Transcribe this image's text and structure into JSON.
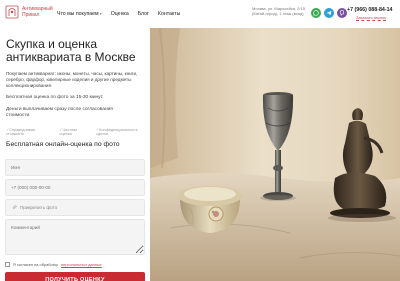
{
  "header": {
    "logo": {
      "line1": "Антикварный",
      "line2": "Привал"
    },
    "nav": [
      {
        "label": "Что мы покупаем",
        "dropdown": true
      },
      {
        "label": "Оценка",
        "dropdown": false
      },
      {
        "label": "Блог",
        "dropdown": false
      },
      {
        "label": "Контакты",
        "dropdown": false
      }
    ],
    "address": "Москва, ул. Маросейка, 2/15 (Китай-город), 1 этаж (вход)",
    "socials": [
      {
        "name": "whatsapp-icon",
        "color": "#3aa94f"
      },
      {
        "name": "telegram-icon",
        "color": "#2ea0d8"
      },
      {
        "name": "viber-icon",
        "color": "#7b519d"
      }
    ],
    "phone": "+7 (966) 088-84-14",
    "callback": "Заказать звонок"
  },
  "main": {
    "title": "Скупка и оценка антиквариата в Москве",
    "description": "Покупаем антиквариат: иконы, монеты, часы, картины, книги, серебро, фарфор, ювелирные изделия и другие предметы коллекционирования.",
    "free_eval": "Бесплатная оценка по фото за 15-30 минут.",
    "payment": "Деньги выплачиваем сразу после согласования стоимости.",
    "badges": [
      "Справедливая стоимость",
      "Честная оценка",
      "Конфиденциальность сделки"
    ]
  },
  "form": {
    "title": "Бесплатная онлайн-оценка по фото",
    "name_placeholder": "Имя",
    "phone_placeholder": "+7 (000) 000-00-00",
    "file_label": "Прикрепить фото",
    "comment_placeholder": "Комментарий",
    "agree_text": "Я согласен на обработку",
    "agree_link": "персональных данных",
    "submit_label": "ПОЛУЧИТЬ ОЦЕНКУ"
  },
  "photo": {
    "name": "antiques-photo"
  },
  "colors": {
    "accent": "#c82b32",
    "link": "#c6474e"
  }
}
